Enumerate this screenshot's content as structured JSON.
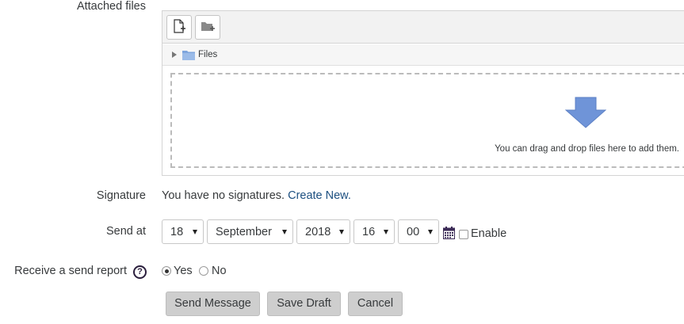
{
  "attached_files": {
    "label": "Attached files",
    "path_label": "Files",
    "drop_text": "You can drag and drop files here to add them."
  },
  "signature": {
    "label": "Signature",
    "text": "You have no signatures.",
    "link": "Create New."
  },
  "send_at": {
    "label": "Send at",
    "day": "18",
    "month": "September",
    "year": "2018",
    "hour": "16",
    "minute": "00",
    "enable_label": "Enable"
  },
  "send_report": {
    "label": "Receive a send report",
    "help": "?",
    "yes_label": "Yes",
    "no_label": "No",
    "selected": "Yes"
  },
  "buttons": {
    "send": "Send Message",
    "save": "Save Draft",
    "cancel": "Cancel"
  },
  "colors": {
    "link": "#1c4f80",
    "arrow": "#6f94d8",
    "folder": "#7ea5dd"
  }
}
